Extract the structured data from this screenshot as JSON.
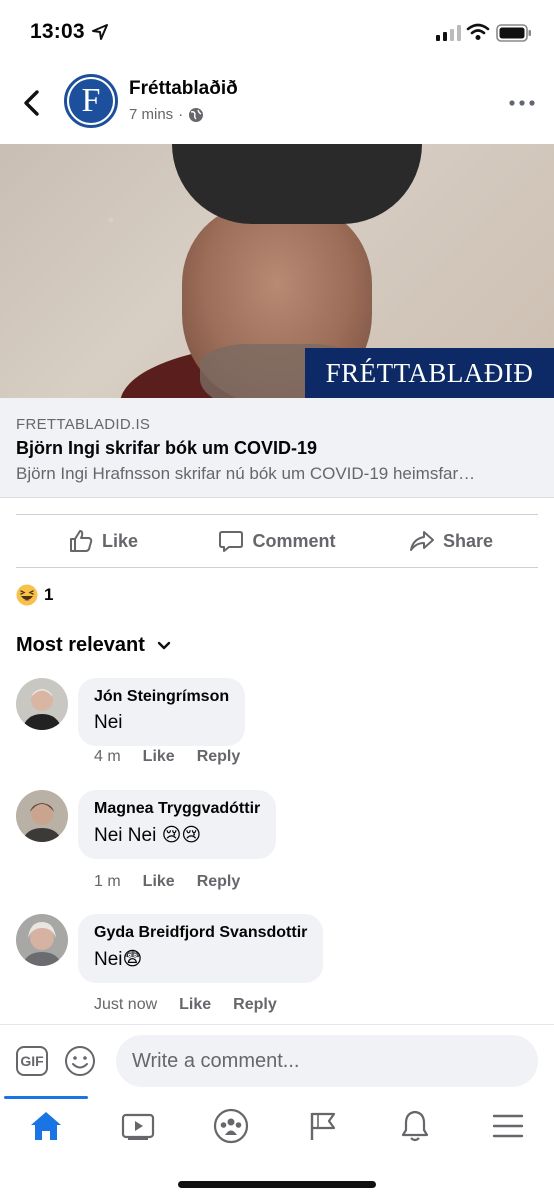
{
  "status_bar": {
    "time": "13:03"
  },
  "header": {
    "page_name": "Fréttablaðið",
    "avatar_letter": "F",
    "post_time": "7 mins",
    "separator": "·"
  },
  "link": {
    "banner": "FRÉTTABLAÐIÐ",
    "domain": "FRETTABLADID.IS",
    "title": "Björn Ingi skrifar bók um COVID-19",
    "description": "Björn Ingi Hrafnsson skrifar nú bók um COVID-19 heimsfar…"
  },
  "actions": {
    "like": "Like",
    "comment": "Comment",
    "share": "Share"
  },
  "reactions": {
    "count": "1"
  },
  "sort": {
    "label": "Most relevant"
  },
  "comments": [
    {
      "name": "Jón Steingrímson",
      "text": "Nei",
      "time": "4 m",
      "like": "Like",
      "reply": "Reply"
    },
    {
      "name": "Magnea Tryggvadóttir",
      "text": "Nei Nei 😢😢",
      "time": "1 m",
      "like": "Like",
      "reply": "Reply"
    },
    {
      "name": "Gyda Breidfjord Svansdottir",
      "text": "Nei😨",
      "time": "Just now",
      "like": "Like",
      "reply": "Reply"
    }
  ],
  "composer": {
    "gif": "GIF",
    "placeholder": "Write a comment..."
  },
  "colors": {
    "brand_blue": "#1b74e4",
    "page_blue": "#1c4f9c",
    "muted": "#65676b",
    "bubble": "#f0f2f5"
  },
  "icons": [
    "location-arrow-icon",
    "signal-icon",
    "wifi-icon",
    "battery-icon",
    "back-icon",
    "globe-icon",
    "more-icon",
    "like-icon",
    "comment-icon",
    "share-icon",
    "haha-icon",
    "chevron-down-icon",
    "emoji-icon",
    "home-icon",
    "watch-icon",
    "groups-icon",
    "pages-icon",
    "bell-icon",
    "menu-icon"
  ]
}
